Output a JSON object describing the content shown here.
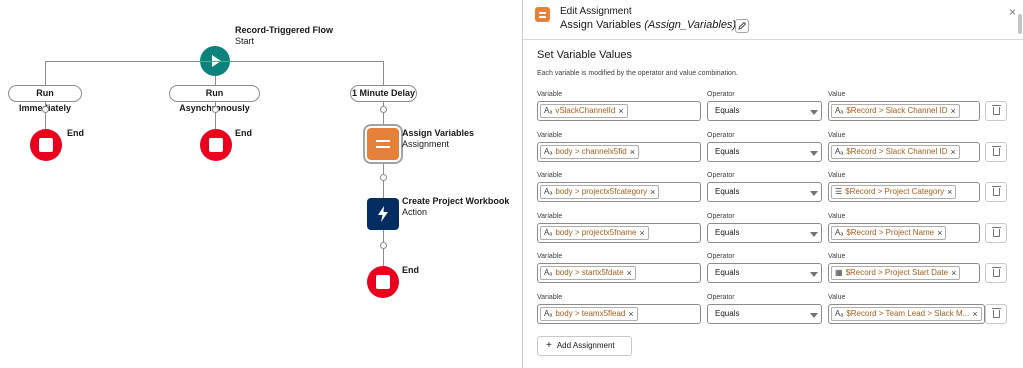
{
  "flow": {
    "start": {
      "title": "Record-Triggered Flow",
      "subtitle": "Start"
    },
    "paths": [
      {
        "label": "Run Immediately",
        "end_label": "End"
      },
      {
        "label": "Run Asynchronously",
        "end_label": "End"
      },
      {
        "label": "1 Minute Delay"
      }
    ],
    "assign_node": {
      "title": "Assign Variables",
      "subtitle": "Assignment"
    },
    "action_node": {
      "title": "Create Project Workbook",
      "subtitle": "Action"
    },
    "final_end_label": "End"
  },
  "panel": {
    "header": {
      "title": "Edit Assignment",
      "subtitle_name": "Assign Variables",
      "subtitle_api": "(Assign_Variables)",
      "close": "×"
    },
    "section_title": "Set Variable Values",
    "section_desc": "Each variable is modified by the operator and value combination.",
    "column_labels": {
      "variable": "Variable",
      "operator": "Operator",
      "value": "Value"
    },
    "assignments": [
      {
        "variable": "vSlackChannelId",
        "operator": "Equals",
        "value": "$Record > Slack Channel ID",
        "value_icon": "text-icon"
      },
      {
        "variable": "body > channelx5fid",
        "operator": "Equals",
        "value": "$Record > Slack Channel ID",
        "value_icon": "text-icon"
      },
      {
        "variable": "body > projectx5fcategory",
        "operator": "Equals",
        "value": "$Record > Project Category",
        "value_icon": "picklist-icon"
      },
      {
        "variable": "body > projectx5fname",
        "operator": "Equals",
        "value": "$Record > Project Name",
        "value_icon": "text-icon"
      },
      {
        "variable": "body > startx5fdate",
        "operator": "Equals",
        "value": "$Record > Project Start Date",
        "value_icon": "calendar-icon"
      },
      {
        "variable": "body > teamx5flead",
        "operator": "Equals",
        "value": "$Record > Team Lead > Slack M...",
        "value_icon": "text-icon"
      }
    ],
    "add_button": "Add Assignment"
  },
  "colors": {
    "start": "#0b827c",
    "end": "#ea001e",
    "assignment": "#e4813a",
    "action": "#032d60",
    "chip_text": "#a35f1e"
  }
}
